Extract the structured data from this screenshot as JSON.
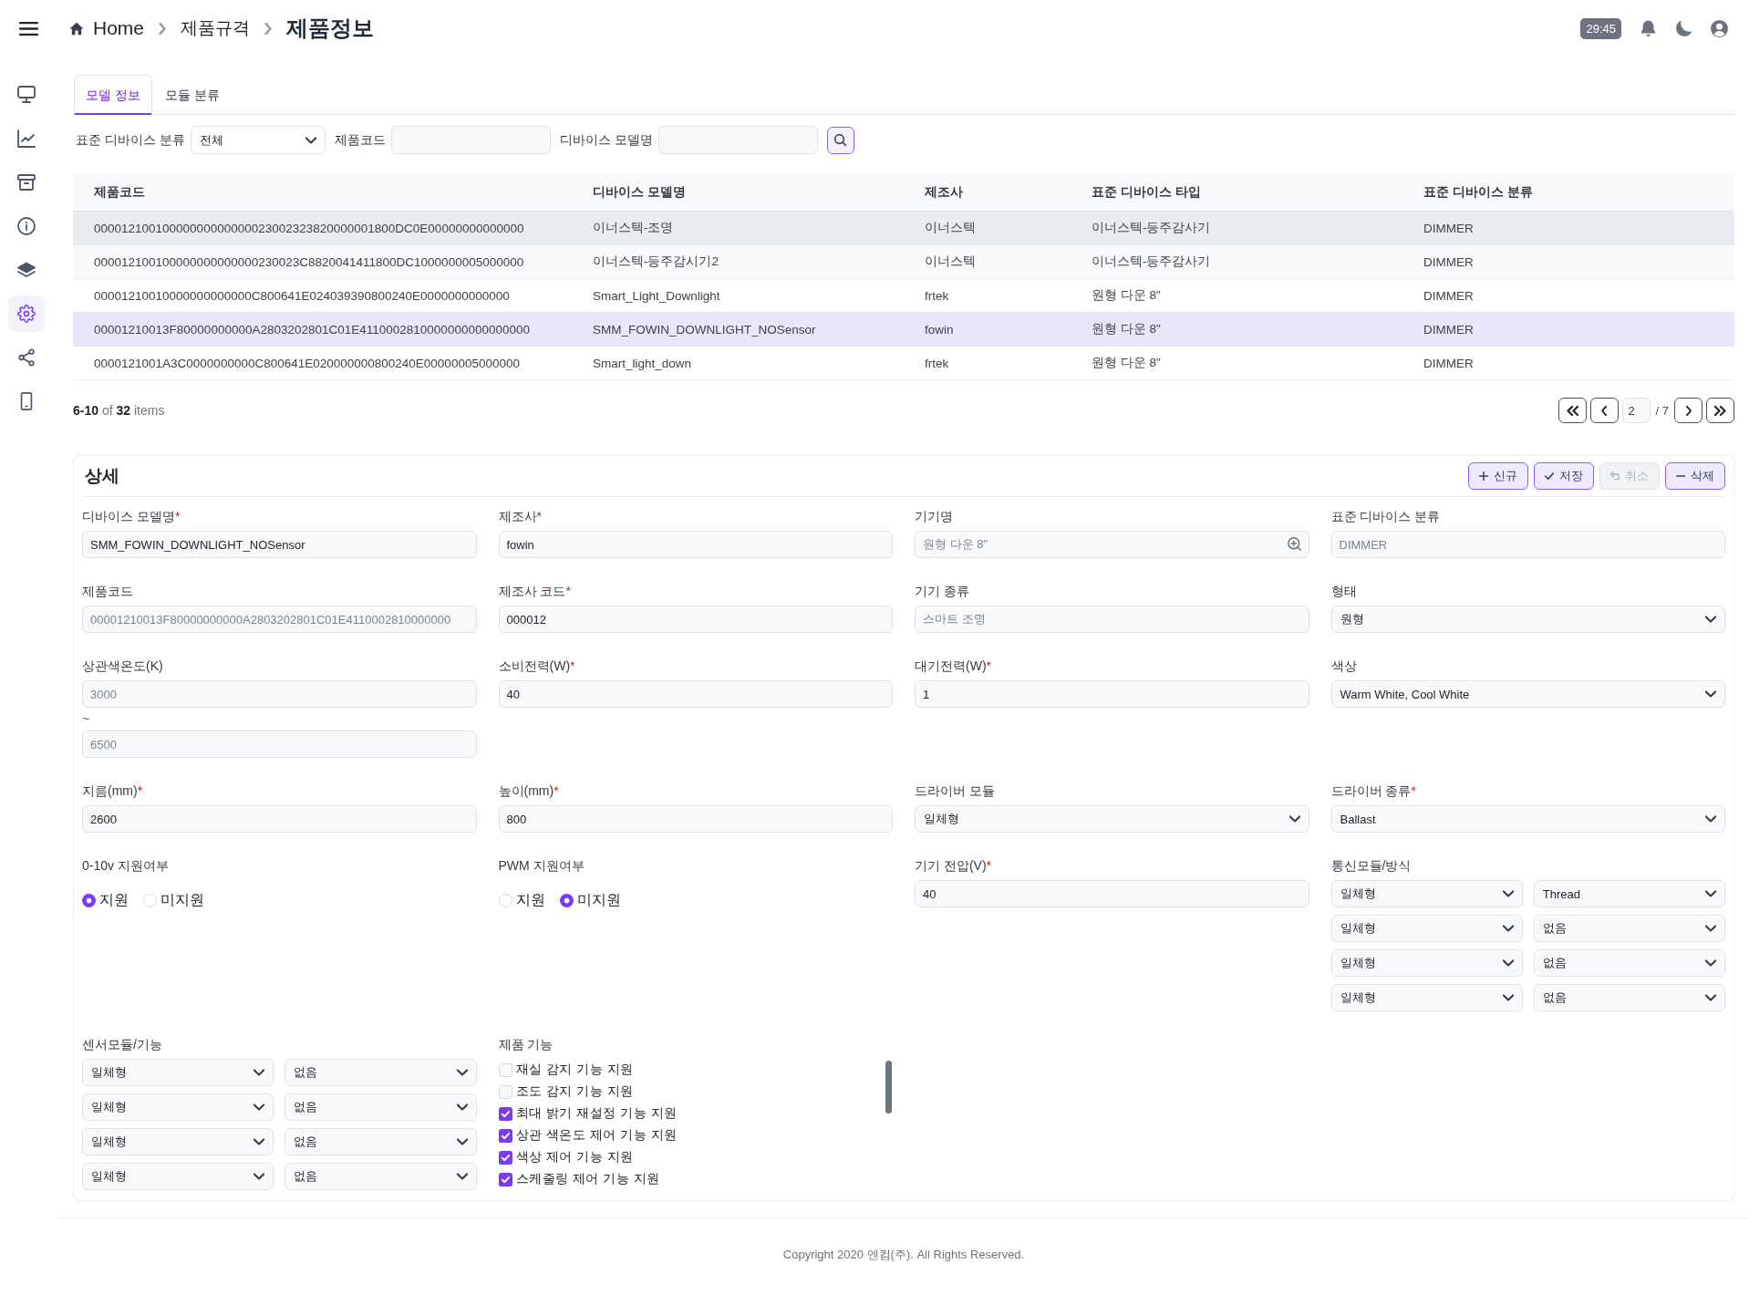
{
  "sidebar": {
    "items": [
      {
        "selected": false
      },
      {
        "selected": false
      },
      {
        "selected": false
      },
      {
        "selected": false
      },
      {
        "selected": false
      },
      {
        "selected": true
      },
      {
        "selected": false
      },
      {
        "selected": false
      }
    ]
  },
  "header": {
    "breadcrumb": [
      "Home",
      "제품규격",
      "제품정보"
    ],
    "timer": "29:45"
  },
  "tabs": [
    {
      "label": "모델 정보",
      "selected": true
    },
    {
      "label": "모듈 분류",
      "selected": false
    }
  ],
  "filters": [
    {
      "kind": "select",
      "label": "표준 디바이스 분류",
      "value": "전체"
    },
    {
      "kind": "input",
      "label": "제품코드"
    },
    {
      "kind": "input",
      "label": "디바이스 모델명"
    }
  ],
  "table": {
    "columns": [
      "제품코드",
      "디바이스 모델명",
      "제조사",
      "표준 디바이스 타입",
      "표준 디바이스 분류"
    ],
    "rows": [
      {
        "cells": [
          "00001210010000000000000023002323820000001800DC0E00000000000000",
          "이너스텍-조명",
          "이너스텍",
          "이너스텍-등주감사기",
          "DIMMER"
        ],
        "selected": false,
        "hovered": true
      },
      {
        "cells": [
          "000012100100000000000000230023C8820041411800DC1000000005000000",
          "이너스텍-등주감시기2",
          "이너스텍",
          "이너스텍-등주감사기",
          "DIMMER"
        ],
        "selected": false,
        "hovered": false
      },
      {
        "cells": [
          "00001210010000000000000C800641E024039390800240E0000000000000",
          "Smart_Light_Downlight",
          "frtek",
          "원형 다운 8\"",
          "DIMMER"
        ],
        "selected": false,
        "hovered": false
      },
      {
        "cells": [
          "00001210013F80000000000A2803202801C01E4110002810000000000000000",
          "SMM_FOWIN_DOWNLIGHT_NOSensor",
          "fowin",
          "원형 다운 8\"",
          "DIMMER"
        ],
        "selected": true,
        "hovered": false
      },
      {
        "cells": [
          "0000121001A3C0000000000C800641E020000000800240E00000005000000",
          "Smart_light_down",
          "frtek",
          "원형 다운 8\"",
          "DIMMER"
        ],
        "selected": false,
        "hovered": false
      }
    ]
  },
  "pagination": {
    "summary": "**6-10** of **32** items",
    "page": "2",
    "page_count": "/ 7"
  },
  "detail": {
    "title": "상세",
    "buttons": [
      {
        "kind": "add",
        "label": "신규",
        "disabled": false
      },
      {
        "kind": "save",
        "label": "저장",
        "disabled": false
      },
      {
        "kind": "cancel",
        "label": "취소",
        "disabled": true
      },
      {
        "kind": "delete",
        "label": "삭제",
        "disabled": false
      }
    ],
    "fields": [
      {
        "kind": "text",
        "label": "디바이스 모델명",
        "mark": "*",
        "value": "SMM_FOWIN_DOWNLIGHT_NOSensor",
        "disabled": false
      },
      {
        "kind": "text",
        "label": "제조사",
        "mark": "*",
        "value": "fowin",
        "disabled": false
      },
      {
        "kind": "lookup",
        "label": "기기명",
        "value": "원형 다운 8\"",
        "disabled": true
      },
      {
        "kind": "text",
        "label": "표준 디바이스 분류",
        "value": "DIMMER",
        "disabled": true
      },
      {
        "kind": "text",
        "label": "제품코드",
        "value": "00001210013F80000000000A2803202801C01E4110002810000000",
        "disabled": true
      },
      {
        "kind": "text",
        "label": "제조사 코드",
        "mark": "*",
        "value": "000012",
        "disabled": false
      },
      {
        "kind": "text",
        "label": "기기 종류",
        "value": "스마트 조명",
        "disabled": true
      },
      {
        "kind": "select",
        "label": "형태",
        "value": "원형"
      },
      {
        "kind": "range",
        "label": "상관색온도(K)",
        "values": [
          "3000",
          "6500"
        ],
        "separator": "~",
        "disabled": true
      },
      {
        "kind": "text",
        "label": "소비전력(W)",
        "mark": "*",
        "value": "40",
        "disabled": false
      },
      {
        "kind": "text",
        "label": "대기전력(W)",
        "mark": "*",
        "value": "1",
        "disabled": false
      },
      {
        "kind": "select",
        "label": "색상",
        "value": "Warm White, Cool White"
      },
      {
        "kind": "text",
        "label": "지름(mm)",
        "mark": "*",
        "value": "2600",
        "disabled": false
      },
      {
        "kind": "text",
        "label": "높이(mm)",
        "mark": "*",
        "value": "800",
        "disabled": false
      },
      {
        "kind": "select",
        "label": "드라이버 모듈",
        "value": "일체형"
      },
      {
        "kind": "select",
        "label": "드라이버 종류",
        "mark": "*",
        "value": "Ballast"
      },
      {
        "kind": "radio",
        "label": "0-10v 지원여부",
        "options": [
          {
            "label": "지원",
            "selected": true
          },
          {
            "label": "미지원",
            "selected": false
          }
        ]
      },
      {
        "kind": "radio",
        "label": "PWM 지원여부",
        "options": [
          {
            "label": "지원",
            "selected": false
          },
          {
            "label": "미지원",
            "selected": true
          }
        ]
      },
      {
        "kind": "text",
        "label": "기기 전압(V)",
        "mark": "*",
        "value": "40",
        "disabled": false
      },
      {
        "kind": "pairs",
        "label": "통신모듈/방식",
        "rows": [
          [
            "일체형",
            "Thread"
          ],
          [
            "일체형",
            "없음"
          ],
          [
            "일체형",
            "없음"
          ],
          [
            "일체형",
            "없음"
          ]
        ]
      },
      {
        "kind": "pairs",
        "label": "센서모듈/기능",
        "rows": [
          [
            "일체형",
            "없음"
          ],
          [
            "일체형",
            "없음"
          ],
          [
            "일체형",
            "없음"
          ],
          [
            "일체형",
            "없음"
          ]
        ]
      },
      {
        "kind": "checklist",
        "label": "제품 기능",
        "items": [
          {
            "label": "재실 감지 기능 지원",
            "checked": false
          },
          {
            "label": "조도 감지 기능 지원",
            "checked": false
          },
          {
            "label": "최대 밝기 재설정 기능 지원",
            "checked": true
          },
          {
            "label": "상관 색온도 제어 기능 지원",
            "checked": true
          },
          {
            "label": "색상 제어 기능 지원",
            "checked": true
          },
          {
            "label": "스케줄링 제어 기능 지원",
            "checked": true
          }
        ]
      }
    ]
  },
  "footer": {
    "copyright": "Copyright 2020 엔컴(주). All Rights Reserved."
  }
}
